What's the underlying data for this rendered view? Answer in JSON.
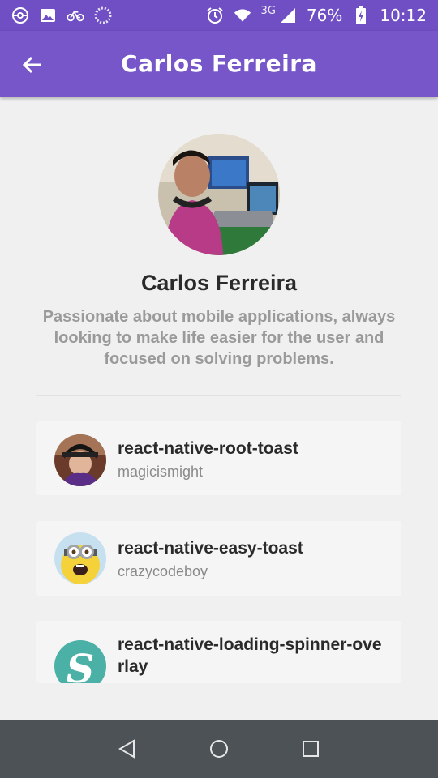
{
  "status_bar": {
    "network": "3G",
    "battery": "76%",
    "time": "10:12",
    "icons_left": [
      "pokeball-icon",
      "image-icon",
      "bike-icon",
      "loading-icon"
    ],
    "icons_right": [
      "alarm-icon",
      "wifi-icon",
      "signal-icon",
      "battery-charging-icon"
    ]
  },
  "app_bar": {
    "title": "Carlos Ferreira",
    "back_icon": "arrow-left-icon",
    "color": "#7656c8"
  },
  "profile": {
    "name": "Carlos Ferreira",
    "bio": "Passionate about mobile applications, always looking to make life easier for the user and focused on solving problems."
  },
  "repositories": [
    {
      "title": "react-native-root-toast",
      "owner": "magicismight"
    },
    {
      "title": "react-native-easy-toast",
      "owner": "crazycodeboy"
    },
    {
      "title": "react-native-loading-spinner-overlay",
      "owner": ""
    }
  ],
  "nav_bar": {
    "buttons": [
      "back-triangle-icon",
      "home-circle-icon",
      "recents-square-icon"
    ]
  }
}
